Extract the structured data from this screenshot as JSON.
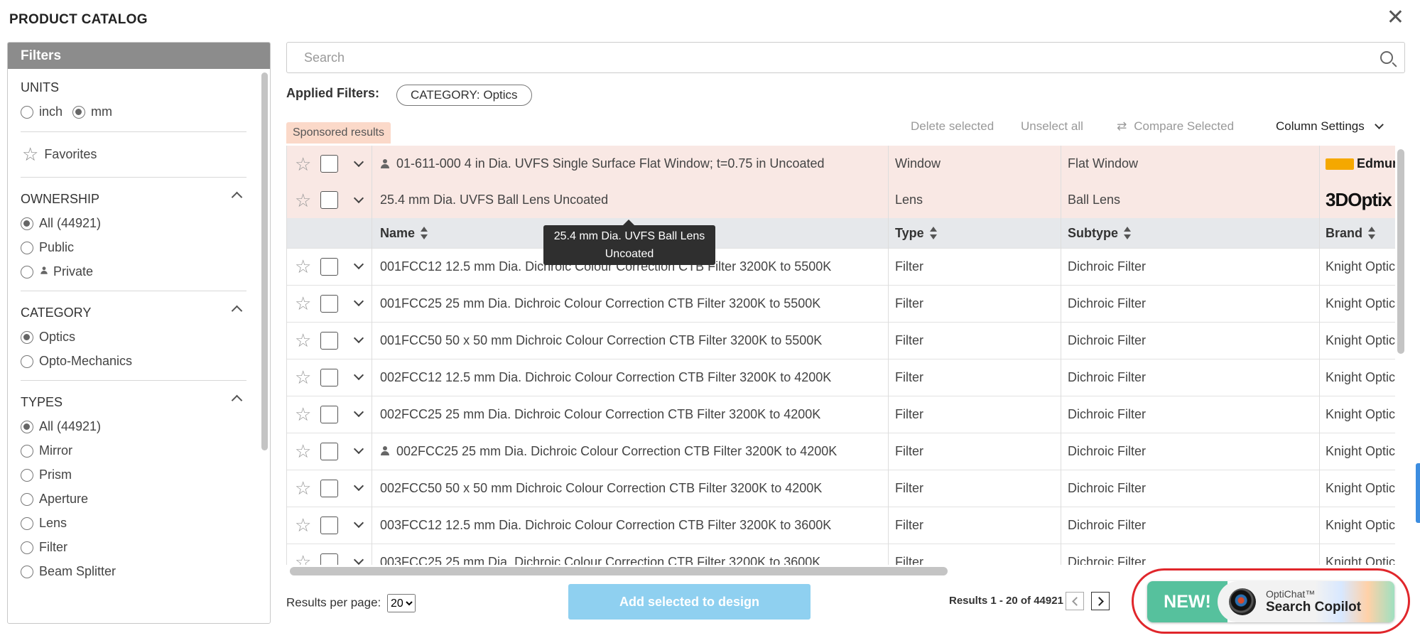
{
  "header": {
    "title": "PRODUCT CATALOG",
    "close_glyph": "✕"
  },
  "filters": {
    "title": "Filters",
    "units": {
      "label": "UNITS",
      "options": [
        {
          "label": "inch",
          "selected": false
        },
        {
          "label": "mm",
          "selected": true
        }
      ]
    },
    "favorites_label": "Favorites",
    "ownership": {
      "label": "OWNERSHIP",
      "options": [
        {
          "label": "All (44921)",
          "selected": true
        },
        {
          "label": "Public",
          "selected": false
        },
        {
          "label": "Private",
          "selected": false
        }
      ]
    },
    "category": {
      "label": "CATEGORY",
      "options": [
        {
          "label": "Optics",
          "selected": true
        },
        {
          "label": "Opto-Mechanics",
          "selected": false
        }
      ]
    },
    "types": {
      "label": "TYPES",
      "options": [
        {
          "label": "All (44921)",
          "selected": true
        },
        {
          "label": "Mirror",
          "selected": false
        },
        {
          "label": "Prism",
          "selected": false
        },
        {
          "label": "Aperture",
          "selected": false
        },
        {
          "label": "Lens",
          "selected": false
        },
        {
          "label": "Filter",
          "selected": false
        },
        {
          "label": "Beam Splitter",
          "selected": false
        }
      ]
    }
  },
  "search": {
    "placeholder": "Search",
    "value": ""
  },
  "applied_filters": {
    "label": "Applied Filters:",
    "chips": [
      "CATEGORY: Optics"
    ]
  },
  "sponsored_label": "Sponsored results",
  "toolbar": {
    "delete_selected": "Delete selected",
    "unselect_all": "Unselect all",
    "compare_selected": "Compare Selected",
    "column_settings": "Column Settings"
  },
  "table": {
    "columns": {
      "name": "Name",
      "type": "Type",
      "subtype": "Subtype",
      "brand": "Brand"
    },
    "sponsored_rows": [
      {
        "name": "01-611-000 4 in Dia. UVFS Single Surface Flat Window; t=0.75 in Uncoated",
        "private": true,
        "type": "Window",
        "subtype": "Flat Window",
        "brand_logo": "Edmund"
      },
      {
        "name": "25.4 mm Dia. UVFS Ball Lens Uncoated",
        "private": false,
        "type": "Lens",
        "subtype": "Ball Lens",
        "brand_logo": "3DOptix"
      }
    ],
    "rows": [
      {
        "name": "001FCC12 12.5 mm Dia. Dichroic Colour Correction CTB Filter 3200K to 5500K",
        "private": false,
        "type": "Filter",
        "subtype": "Dichroic Filter",
        "brand": "Knight Optical"
      },
      {
        "name": "001FCC25 25 mm Dia. Dichroic Colour Correction CTB Filter 3200K to 5500K",
        "private": false,
        "type": "Filter",
        "subtype": "Dichroic Filter",
        "brand": "Knight Optical"
      },
      {
        "name": "001FCC50 50 x 50 mm Dichroic Colour Correction CTB Filter 3200K to 5500K",
        "private": false,
        "type": "Filter",
        "subtype": "Dichroic Filter",
        "brand": "Knight Optical"
      },
      {
        "name": "002FCC12 12.5 mm Dia. Dichroic Colour Correction CTB Filter 3200K to 4200K",
        "private": false,
        "type": "Filter",
        "subtype": "Dichroic Filter",
        "brand": "Knight Optical"
      },
      {
        "name": "002FCC25 25 mm Dia. Dichroic Colour Correction CTB Filter 3200K to 4200K",
        "private": false,
        "type": "Filter",
        "subtype": "Dichroic Filter",
        "brand": "Knight Optical"
      },
      {
        "name": "002FCC25 25 mm Dia. Dichroic Colour Correction CTB Filter 3200K to 4200K",
        "private": true,
        "type": "Filter",
        "subtype": "Dichroic Filter",
        "brand": "Knight Optical"
      },
      {
        "name": "002FCC50 50 x 50 mm Dichroic Colour Correction CTB Filter 3200K to 4200K",
        "private": false,
        "type": "Filter",
        "subtype": "Dichroic Filter",
        "brand": "Knight Optical"
      },
      {
        "name": "003FCC12 12.5 mm Dia. Dichroic Colour Correction CTB Filter 3200K to 3600K",
        "private": false,
        "type": "Filter",
        "subtype": "Dichroic Filter",
        "brand": "Knight Optical"
      },
      {
        "name": "003FCC25 25 mm Dia. Dichroic Colour Correction CTB Filter 3200K to 3600K",
        "private": false,
        "type": "Filter",
        "subtype": "Dichroic Filter",
        "brand": "Knight Optical"
      }
    ]
  },
  "tooltip": {
    "line1": "25.4 mm Dia. UVFS Ball Lens",
    "line2": "Uncoated"
  },
  "footer": {
    "results_per_page_label": "Results per page:",
    "results_per_page_value": "20",
    "add_button": "Add selected to design",
    "results_text": "Results 1 - 20 of 44921"
  },
  "copilot": {
    "badge": "NEW!",
    "line1": "OptiChat™",
    "line2": "Search Copilot"
  },
  "colors": {
    "accent_green": "#56c19d",
    "button_blue": "#8fd0f0",
    "sponsored_bg": "#f9e8e4",
    "highlight_ring": "#e0262b"
  }
}
